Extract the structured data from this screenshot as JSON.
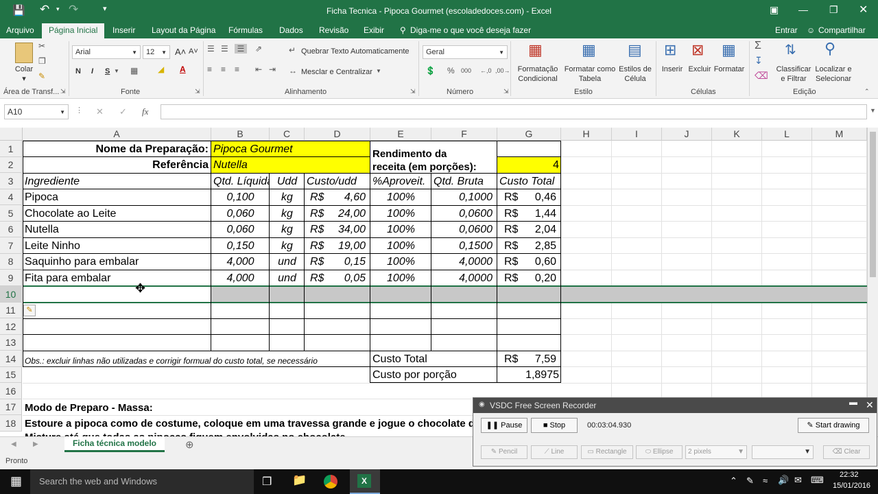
{
  "window": {
    "title": "Ficha Tecnica - Pipoca Gourmet (escoladedoces.com) - Excel"
  },
  "ribbon_tabs": [
    "Arquivo",
    "Página Inicial",
    "Inserir",
    "Layout da Página",
    "Fórmulas",
    "Dados",
    "Revisão",
    "Exibir"
  ],
  "tellme": "Diga-me o que você deseja fazer",
  "signin": "Entrar",
  "share": "Compartilhar",
  "ribbon": {
    "paste": "Colar",
    "font_name": "Arial",
    "font_size": "12",
    "bold": "N",
    "italic": "I",
    "underline": "S",
    "wrap_text": "Quebrar Texto Automaticamente",
    "merge_center": "Mesclar e Centralizar",
    "number_format": "Geral",
    "cond_format_1": "Formatação",
    "cond_format_2": "Condicional",
    "format_table_1": "Formatar como",
    "format_table_2": "Tabela",
    "cell_styles_1": "Estilos de",
    "cell_styles_2": "Célula",
    "insert": "Inserir",
    "delete": "Excluir",
    "format": "Formatar",
    "sort_1": "Classificar",
    "sort_2": "e Filtrar",
    "find_1": "Localizar e",
    "find_2": "Selecionar",
    "groups": [
      "Área de Transf...",
      "Fonte",
      "Alinhamento",
      "Número",
      "Estilo",
      "Células",
      "Edição"
    ]
  },
  "formula_bar": {
    "name_box": "A10",
    "fx": "fx",
    "content": ""
  },
  "columns": [
    "A",
    "B",
    "C",
    "D",
    "E",
    "F",
    "G",
    "H",
    "I",
    "J",
    "K",
    "L",
    "M"
  ],
  "rows": [
    "1",
    "2",
    "3",
    "4",
    "5",
    "6",
    "7",
    "8",
    "9",
    "10",
    "11",
    "12",
    "13",
    "14",
    "15",
    "16",
    "17",
    "18"
  ],
  "sheet": {
    "a1": "Nome da Preparação:",
    "b1": "Pipoca Gourmet",
    "a2": "Referência",
    "b2": "Nutella",
    "e1": "Rendimento da",
    "e2": "receita (em porções):",
    "g2": "4",
    "headers": [
      "Ingrediente",
      "Qtd. Líquida",
      "Udd",
      "Custo/udd",
      "%Aproveit.",
      "Qtd. Bruta",
      "Custo Total"
    ],
    "items": [
      {
        "name": "Pipoca",
        "qty": "0,100",
        "unit": "kg",
        "cur": "R$",
        "cost": "4,60",
        "pct": "100%",
        "gross": "0,1000",
        "tcur": "R$",
        "total": "0,46"
      },
      {
        "name": "Chocolate ao Leite",
        "qty": "0,060",
        "unit": "kg",
        "cur": "R$",
        "cost": "24,00",
        "pct": "100%",
        "gross": "0,0600",
        "tcur": "R$",
        "total": "1,44"
      },
      {
        "name": "Nutella",
        "qty": "0,060",
        "unit": "kg",
        "cur": "R$",
        "cost": "34,00",
        "pct": "100%",
        "gross": "0,0600",
        "tcur": "R$",
        "total": "2,04"
      },
      {
        "name": "Leite Ninho",
        "qty": "0,150",
        "unit": "kg",
        "cur": "R$",
        "cost": "19,00",
        "pct": "100%",
        "gross": "0,1500",
        "tcur": "R$",
        "total": "2,85"
      },
      {
        "name": "Saquinho para embalar",
        "qty": "4,000",
        "unit": "und",
        "cur": "R$",
        "cost": "0,15",
        "pct": "100%",
        "gross": "4,0000",
        "tcur": "R$",
        "total": "0,60"
      },
      {
        "name": "Fita para embalar",
        "qty": "4,000",
        "unit": "und",
        "cur": "R$",
        "cost": "0,05",
        "pct": "100%",
        "gross": "4,0000",
        "tcur": "R$",
        "total": "0,20"
      }
    ],
    "obs": "Obs.: excluir linhas não utilizadas e corrigir formual do custo total, se necessário",
    "total_label": "Custo Total",
    "total_cur": "R$",
    "total_value": "7,59",
    "portion_label": "Custo por porção",
    "portion_value": "1,8975",
    "prep_title": "Modo de Preparo - Massa:",
    "prep_line1": "Estoure a pipoca como de costume, coloque em uma travessa grande e jogue o chocolate derretido",
    "prep_line2": "Misture até que todas as pipocas fiquem envolvidas no chocolate"
  },
  "sheet_tab": "Ficha técnica modelo",
  "status": "Pronto",
  "taskbar": {
    "search": "Search the web and Windows",
    "time": "22:32",
    "date": "15/01/2016"
  },
  "vsdc": {
    "title": "VSDC Free Screen Recorder",
    "pause": "Pause",
    "stop": "Stop",
    "timer": "00:03:04.930",
    "start_drawing": "Start drawing",
    "pencil": "Pencil",
    "line": "Line",
    "rectangle": "Rectangle",
    "ellipse": "Ellipse",
    "pixels": "2 pixels",
    "clear": "Clear"
  },
  "colors": {
    "excel_green": "#217346",
    "highlight_yellow": "#ffff00",
    "selected_row": "#c8c8c8"
  }
}
